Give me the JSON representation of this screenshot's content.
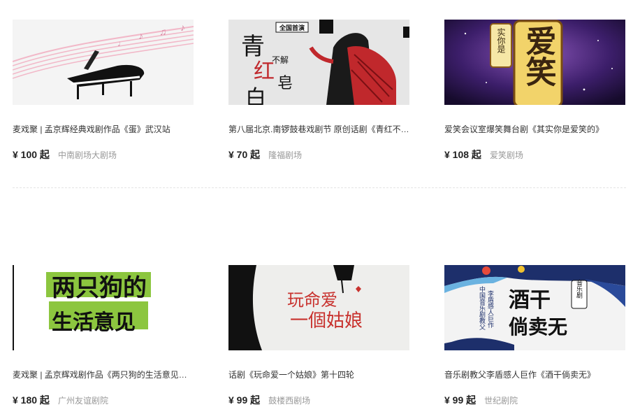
{
  "cards": [
    {
      "title": "麦戏聚 | 孟京辉经典戏剧作品《蛋》武汉站",
      "price": "¥ 100 起",
      "venue": "中南剧场大剧场",
      "icon": "piano-poster"
    },
    {
      "title": "第八届北京.南锣鼓巷戏剧节 原创话剧《青红不解皂白》",
      "price": "¥ 70 起",
      "venue": "隆福剧场",
      "icon": "qinghong-poster",
      "poster_text": {
        "tag": "全国首演",
        "c1": "青",
        "c2": "不解",
        "c3": "红",
        "c4": "皂",
        "c5": "白"
      }
    },
    {
      "title": "爱笑会议室爆笑舞台剧《其实你是爱笑的》",
      "price": "¥ 108 起",
      "venue": "爱笑剧场",
      "icon": "aixiao-poster",
      "poster_text": {
        "side": "实你是",
        "main": "爱笑"
      }
    },
    {
      "title": "麦戏聚 | 孟京辉戏剧作品《两只狗的生活意见》武汉站",
      "price": "¥ 180 起",
      "venue": "广州友谊剧院",
      "icon": "dogs-poster",
      "poster_text": {
        "l1": "两只狗的",
        "l2": "生活意见"
      }
    },
    {
      "title": "话剧《玩命爱一个姑娘》第十四轮",
      "price": "¥ 99 起",
      "venue": "鼓楼西剧场",
      "icon": "wanming-poster",
      "poster_text": {
        "l1": "玩命爱",
        "l2": "一個姑娘"
      }
    },
    {
      "title": "音乐剧教父李盾感人巨作《酒干倘卖无》",
      "price": "¥ 99 起",
      "venue": "世纪剧院",
      "icon": "jiugan-poster",
      "poster_text": {
        "badge": "音乐剧",
        "side1": "李盾感人巨作",
        "side2": "中国音乐剧教父",
        "main1": "酒干",
        "main2": "倘卖无"
      }
    }
  ]
}
